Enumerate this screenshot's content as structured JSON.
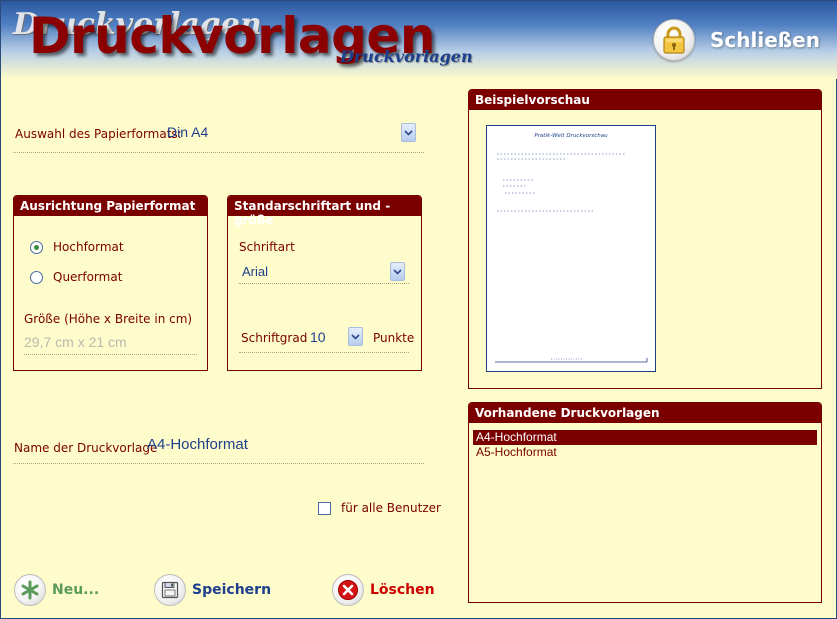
{
  "window": {
    "title": "Druckvorlagen",
    "title_small": "Druckvorlagen",
    "close_label": "Schließen"
  },
  "paper": {
    "label": "Auswahl des Papierformats:",
    "value": "Din A4"
  },
  "orientation": {
    "header": "Ausrichtung Papierformat",
    "options": [
      "Hochformat",
      "Querformat"
    ],
    "selected": "Hochformat",
    "size_label": "Größe (Höhe x Breite in cm)",
    "size_value": "29,7 cm x 21 cm"
  },
  "font": {
    "header": "Standarschriftart und -größe",
    "family_label": "Schriftart",
    "family_value": "Arial",
    "size_label": "Schriftgrad",
    "size_value": "10",
    "size_unit": "Punkte"
  },
  "template_name": {
    "label": "Name der Druckvorlage",
    "value": "A4-Hochformat"
  },
  "all_users": {
    "label": "für alle Benutzer",
    "checked": false
  },
  "buttons": {
    "new": "Neu...",
    "save": "Speichern",
    "delete": "Löschen"
  },
  "preview": {
    "header": "Beispielvorschau",
    "page_title": "Pratik-Welt Druckvorschau"
  },
  "templates": {
    "header": "Vorhandene Druckvorlagen",
    "items": [
      "A4-Hochformat",
      "A5-Hochformat"
    ],
    "selected": "A4-Hochformat"
  },
  "colors": {
    "accent": "#7a0000",
    "background": "#fffccb",
    "value_text": "#1d3f8c",
    "new_button": "#5a9a5a",
    "save_button": "#1d3f8c",
    "delete_button": "#cc0000"
  },
  "icons": {
    "close": "padlock-icon",
    "new": "asterisk-icon",
    "save": "floppy-disk-icon",
    "delete": "red-x-icon",
    "dropdown": "chevron-down-icon"
  }
}
